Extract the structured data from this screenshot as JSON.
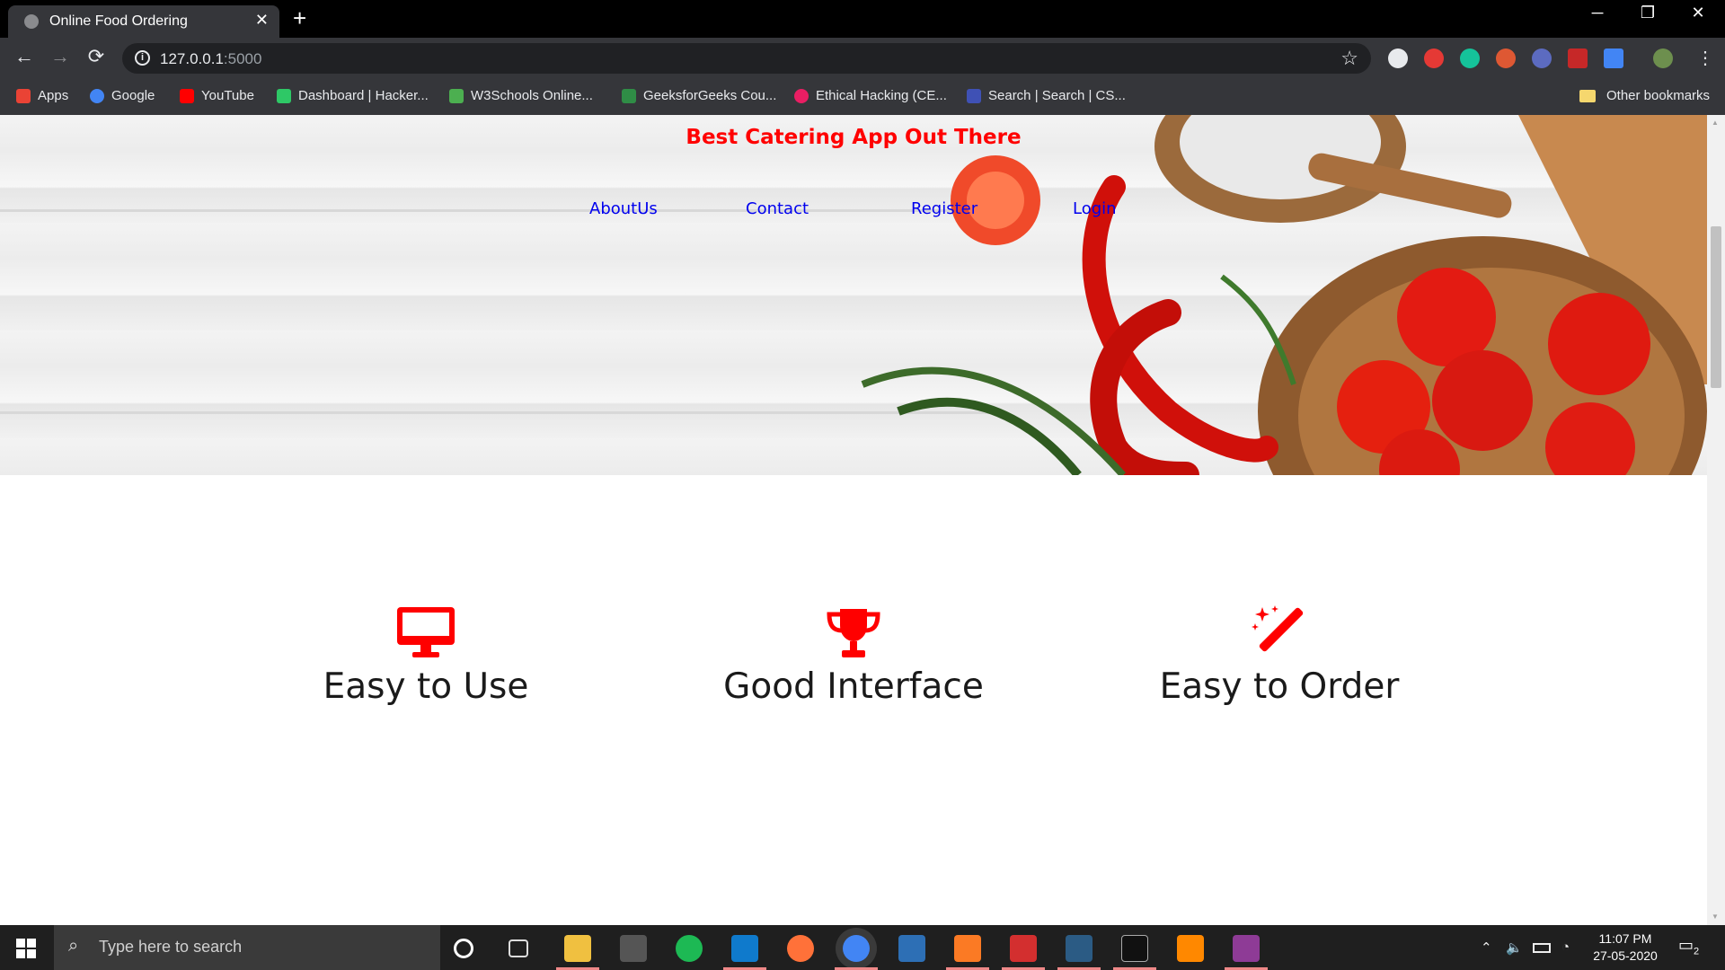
{
  "browser": {
    "tab_title": "Online Food Ordering",
    "tab_close": "✕",
    "new_tab": "+",
    "window_controls": {
      "minimize": "─",
      "restore": "❐",
      "close": "✕"
    },
    "nav": {
      "back": "←",
      "forward": "→",
      "reload": "⟳"
    },
    "address": {
      "host": "127.0.0.1",
      "port": ":5000"
    },
    "star": "☆",
    "menu": "⋮",
    "bookmarks": [
      {
        "label": "Apps",
        "color": "#ea4335"
      },
      {
        "label": "Google",
        "color": "#4285f4"
      },
      {
        "label": "YouTube",
        "color": "#ff0000"
      },
      {
        "label": "Dashboard | Hacker...",
        "color": "#2ec866"
      },
      {
        "label": "W3Schools Online...",
        "color": "#4caf50"
      },
      {
        "label": "GeeksforGeeks Cou...",
        "color": "#2f8d46"
      },
      {
        "label": "Ethical Hacking (CE...",
        "color": "#e91e63"
      },
      {
        "label": "Search | Search | CS...",
        "color": "#3f51b5"
      }
    ],
    "other_bookmarks": "Other bookmarks"
  },
  "page": {
    "site_title": "Best Catering App Out There",
    "nav_links": [
      "AboutUs",
      "Contact",
      "Register",
      "Login"
    ],
    "features": [
      {
        "title": "Easy to Use",
        "icon": "desktop-icon"
      },
      {
        "title": "Good Interface",
        "icon": "trophy-icon"
      },
      {
        "title": "Easy to Order",
        "icon": "magic-wand-icon"
      }
    ],
    "accent_color": "#ff0000"
  },
  "taskbar": {
    "search_placeholder": "Type here to search",
    "time": "11:07 PM",
    "date": "27-05-2020",
    "notification_count": "2"
  }
}
